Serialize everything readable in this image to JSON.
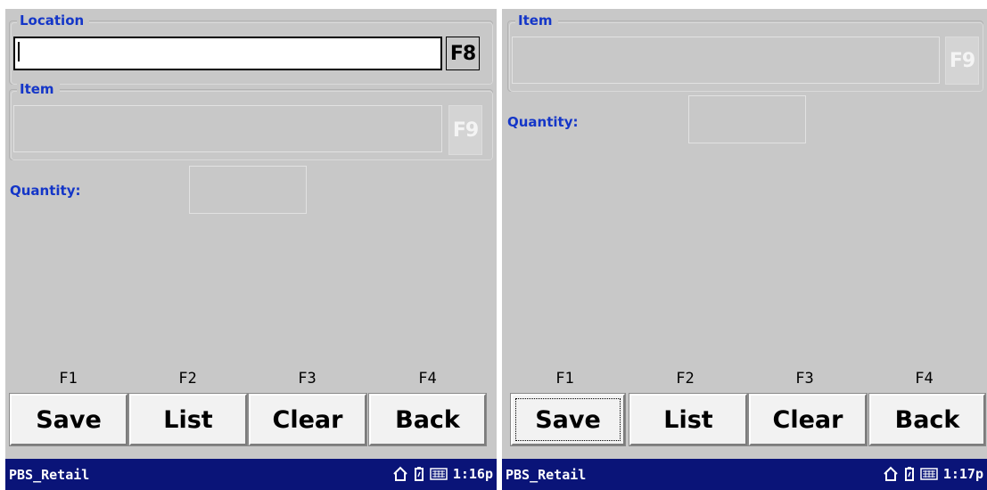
{
  "screens": [
    {
      "location_group": {
        "label": "Location",
        "value": "",
        "fkey": "F8"
      },
      "item_group": {
        "label": "Item",
        "value": "",
        "fkey": "F9"
      },
      "quantity": {
        "label": "Quantity:",
        "value": ""
      },
      "function_keys": [
        "F1",
        "F2",
        "F3",
        "F4"
      ],
      "buttons": {
        "save": "Save",
        "list": "List",
        "clear": "Clear",
        "back": "Back"
      },
      "taskbar": {
        "app": "PBS_Retail",
        "clock": "1:16p"
      }
    },
    {
      "item_group": {
        "label": "Item",
        "value": "",
        "fkey": "F9"
      },
      "quantity": {
        "label": "Quantity:",
        "value": ""
      },
      "function_keys": [
        "F1",
        "F2",
        "F3",
        "F4"
      ],
      "buttons": {
        "save": "Save",
        "list": "List",
        "clear": "Clear",
        "back": "Back"
      },
      "taskbar": {
        "app": "PBS_Retail",
        "clock": "1:17p"
      }
    }
  ],
  "colors": {
    "label_blue": "#1436c8",
    "taskbar": "#0a1478",
    "form_background": "#c8c8c8"
  },
  "icons": [
    "home-icon",
    "battery-icon",
    "keyboard-icon"
  ]
}
